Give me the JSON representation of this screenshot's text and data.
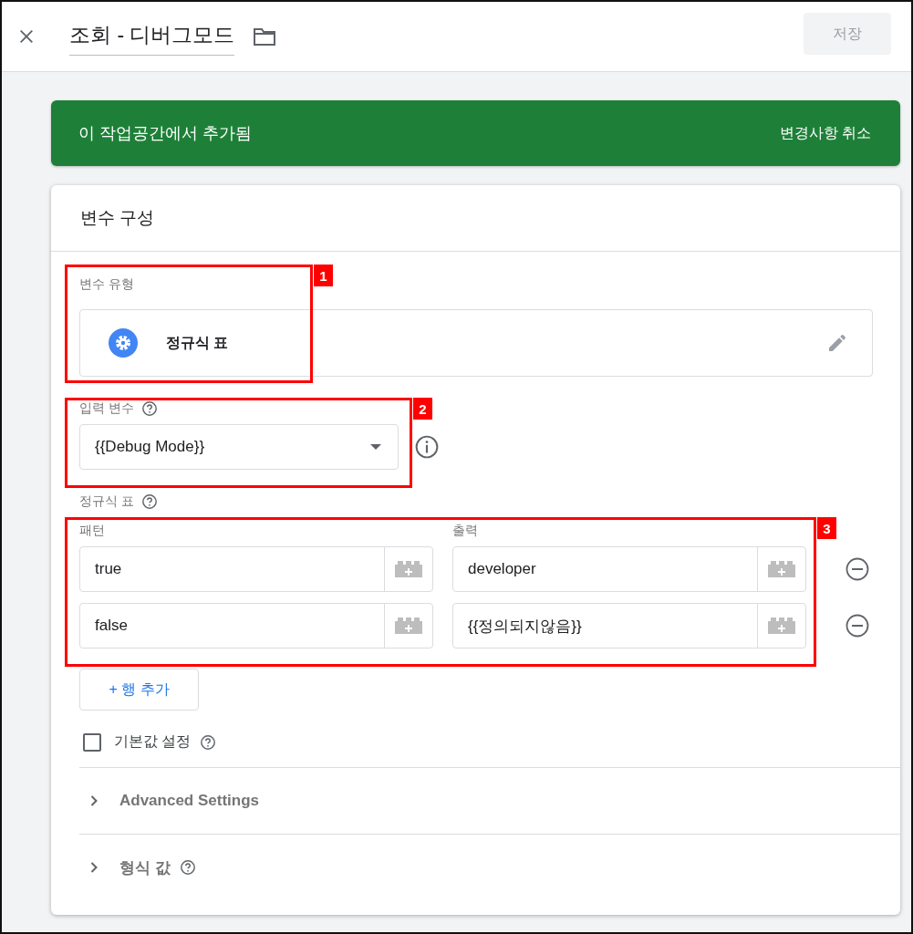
{
  "header": {
    "title": "조회 - 디버그모드",
    "save_button": {
      "label": "저장",
      "disabled": true
    }
  },
  "banner": {
    "message": "이 작업공간에서 추가됨",
    "action": "변경사항 취소"
  },
  "card": {
    "title": "변수 구성"
  },
  "variable_type": {
    "label": "변수 유형",
    "value": "정규식 표"
  },
  "input_variable": {
    "label": "입력 변수",
    "value": "{{Debug Mode}}"
  },
  "regex_table": {
    "label": "정규식 표",
    "columns": [
      "패턴",
      "출력"
    ],
    "rows": [
      {
        "pattern": "true",
        "output": "developer"
      },
      {
        "pattern": "false",
        "output": "{{정의되지않음}}"
      }
    ],
    "add_row": "+ 행 추가"
  },
  "default_value": {
    "label": "기본값 설정",
    "checked": false
  },
  "sections": [
    {
      "label": "Advanced Settings",
      "help": false,
      "expanded": false
    },
    {
      "label": "형식 값",
      "help": true,
      "expanded": false
    }
  ],
  "callouts": [
    "1",
    "2",
    "3"
  ]
}
